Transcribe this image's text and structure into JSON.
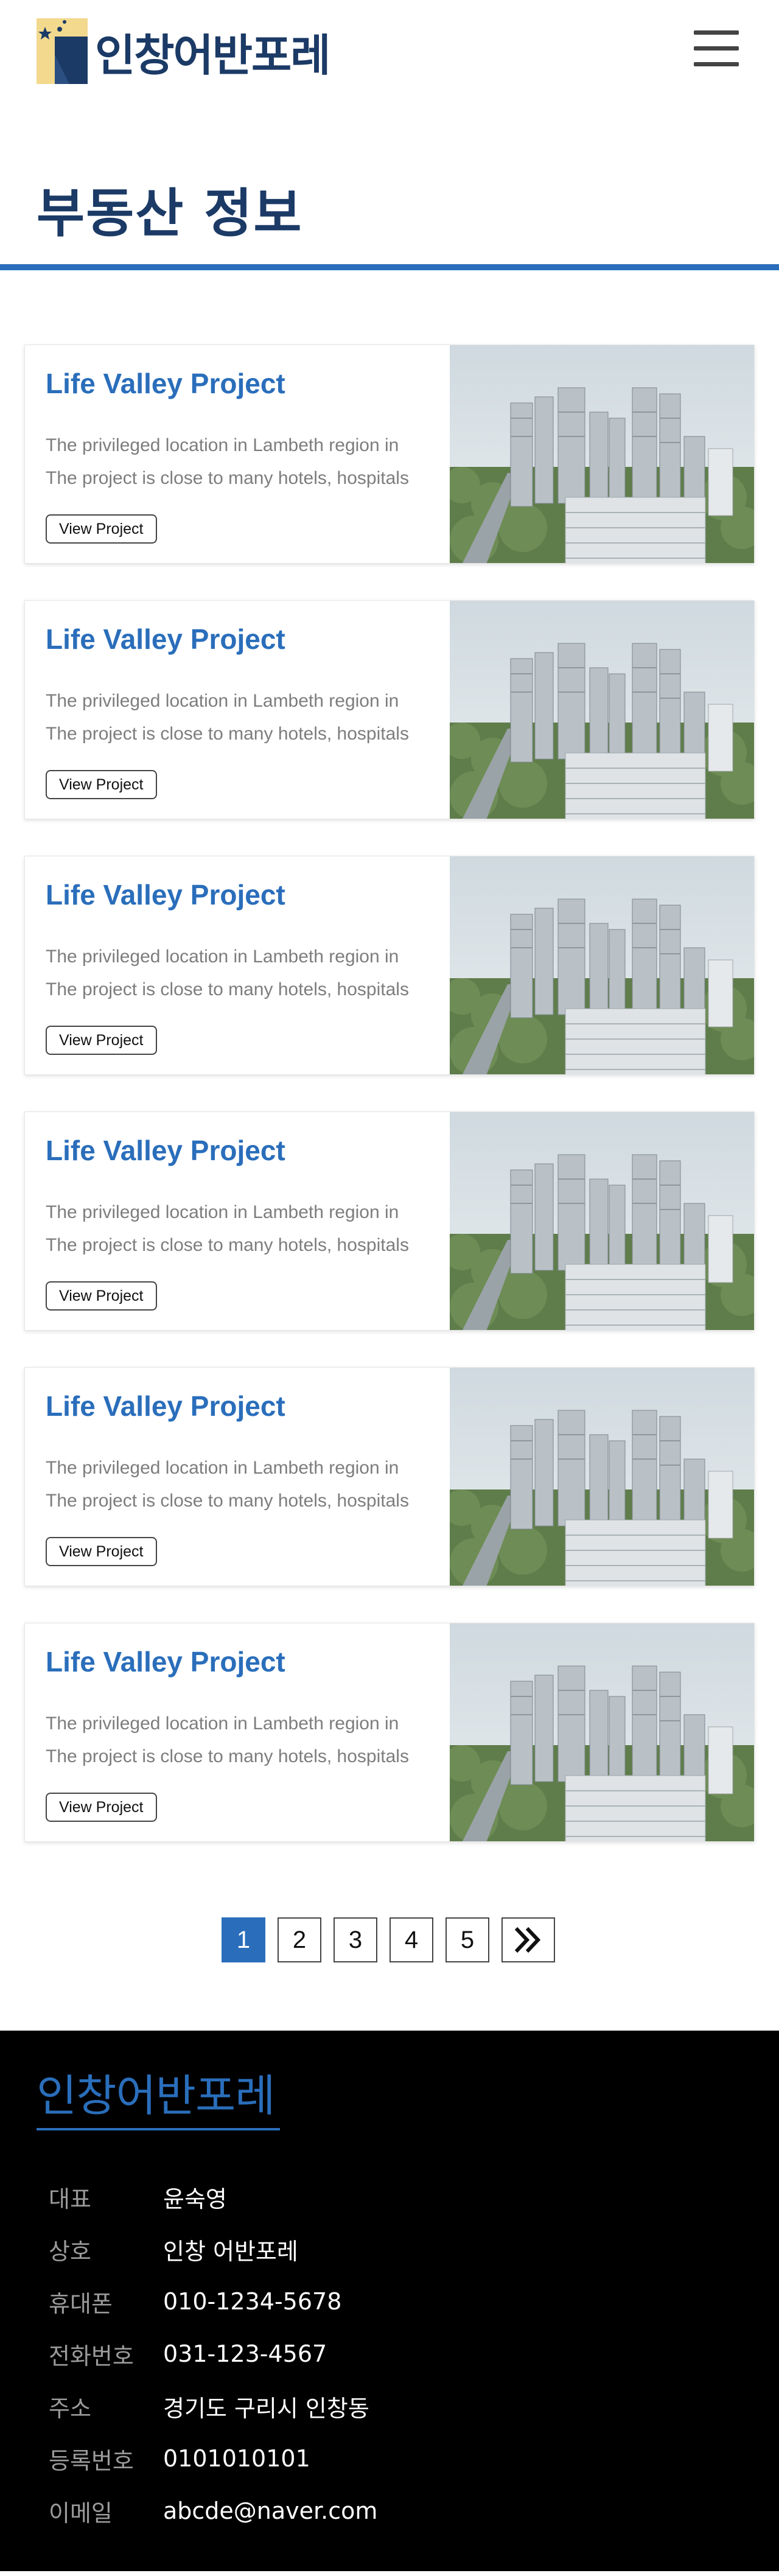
{
  "header": {
    "brand": "인창어반포레",
    "menu_icon": "hamburger-menu-icon",
    "logo_icon": "logo-mark-icon"
  },
  "page": {
    "title": "부동산 정보"
  },
  "colors": {
    "brand_navy": "#1b3a66",
    "accent_blue": "#2a6ebb",
    "footer_bg": "#000000"
  },
  "cards": [
    {
      "title": "Life Valley Project",
      "desc_line1": "The privileged location in Lambeth region in",
      "desc_line2": "The project is close to many hotels, hospitals",
      "button": "View Project"
    },
    {
      "title": "Life Valley Project",
      "desc_line1": "The privileged location in Lambeth region in",
      "desc_line2": "The project is close to many hotels, hospitals",
      "button": "View Project"
    },
    {
      "title": "Life Valley Project",
      "desc_line1": "The privileged location in Lambeth region in",
      "desc_line2": "The project is close to many hotels, hospitals",
      "button": "View Project"
    },
    {
      "title": "Life Valley Project",
      "desc_line1": "The privileged location in Lambeth region in",
      "desc_line2": "The project is close to many hotels, hospitals",
      "button": "View Project"
    },
    {
      "title": "Life Valley Project",
      "desc_line1": "The privileged location in Lambeth region in",
      "desc_line2": "The project is close to many hotels, hospitals",
      "button": "View Project"
    },
    {
      "title": "Life Valley Project",
      "desc_line1": "The privileged location in Lambeth region in",
      "desc_line2": "The project is close to many hotels, hospitals",
      "button": "View Project"
    }
  ],
  "pagination": {
    "pages": [
      "1",
      "2",
      "3",
      "4",
      "5"
    ],
    "current": "1",
    "next_icon": "double-chevron-right-icon"
  },
  "footer": {
    "brand": "인창어반포레",
    "rows": [
      {
        "label": "대표",
        "value": "윤숙영"
      },
      {
        "label": "상호",
        "value": "인창 어반포레"
      },
      {
        "label": "휴대폰",
        "value": "010-1234-5678"
      },
      {
        "label": "전화번호",
        "value": "031-123-4567"
      },
      {
        "label": "주소",
        "value": "경기도 구리시 인창동"
      },
      {
        "label": "등록번호",
        "value": "0101010101"
      },
      {
        "label": "이메일",
        "value": "abcde@naver.com"
      }
    ]
  }
}
